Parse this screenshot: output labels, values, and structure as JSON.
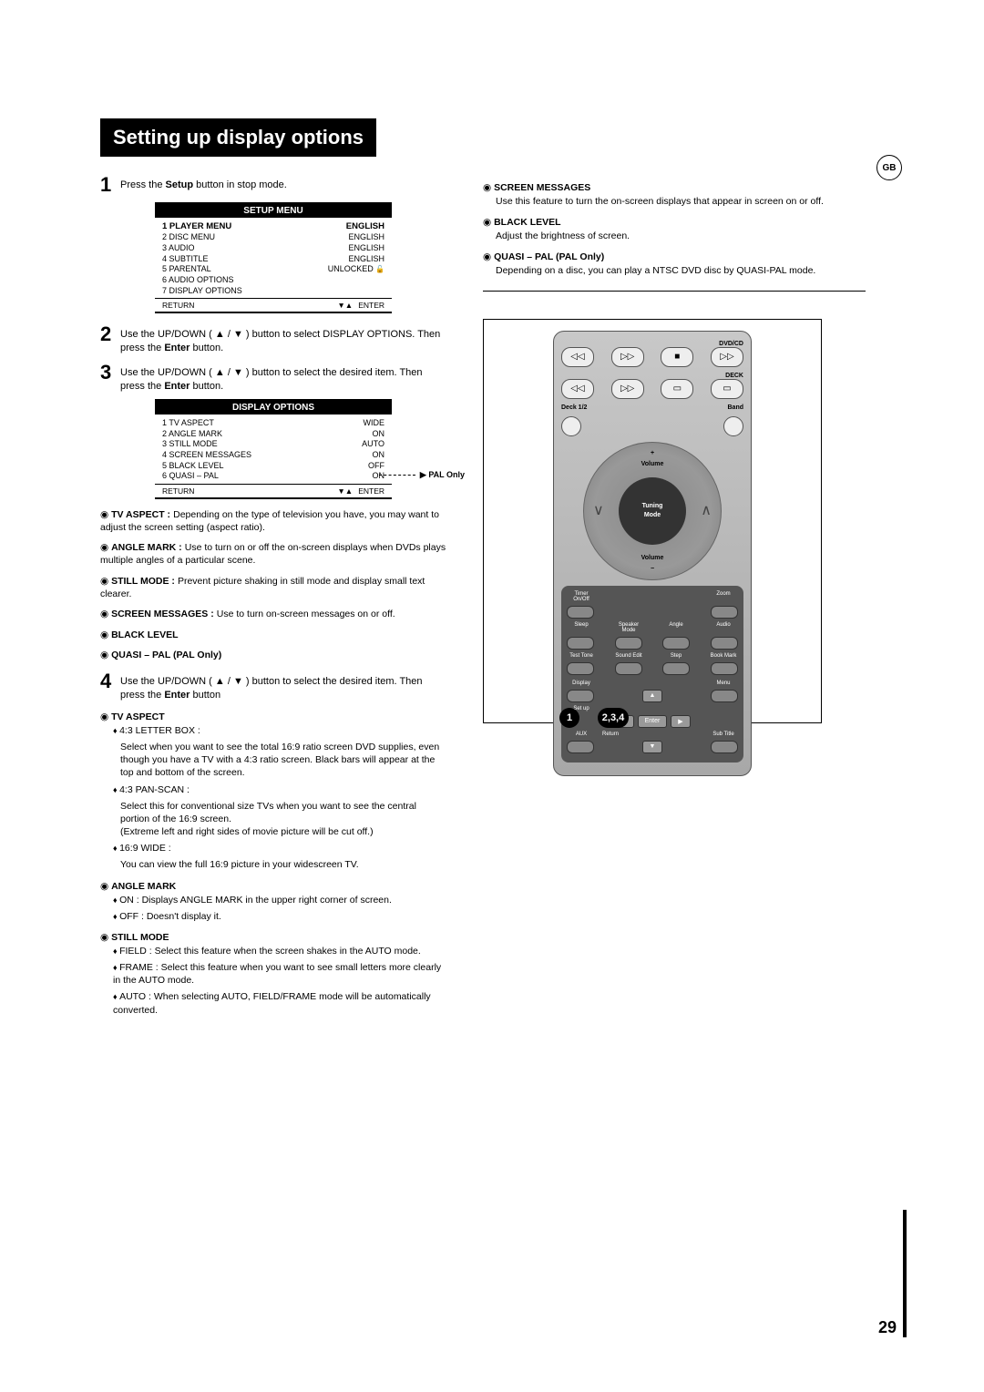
{
  "badge": "GB",
  "title": "Setting up display options",
  "page_num": "29",
  "steps": {
    "s1": {
      "num": "1",
      "text_a": "Press the ",
      "bold": "Setup",
      "text_b": " button in stop mode."
    },
    "s2": {
      "num": "2",
      "text_a": "Use the UP/DOWN ( ▲ / ▼ ) button to select DISPLAY OPTIONS. Then press the ",
      "bold": "Enter",
      "text_b": " button."
    },
    "s3": {
      "num": "3",
      "text_a": "Use the UP/DOWN ( ▲ / ▼ ) button to select the desired item. Then press the ",
      "bold": "Enter",
      "text_b": " button."
    },
    "s4": {
      "num": "4",
      "text_a": "Use the UP/DOWN ( ▲ / ▼ ) button to select the desired item. Then press the ",
      "bold": "Enter",
      "text_b": " button"
    }
  },
  "menu1": {
    "header": "SETUP MENU",
    "rows": [
      {
        "l": "1 PLAYER MENU",
        "r": "ENGLISH",
        "bold": true
      },
      {
        "l": "2 DISC MENU",
        "r": "ENGLISH"
      },
      {
        "l": "3 AUDIO",
        "r": "ENGLISH"
      },
      {
        "l": "4 SUBTITLE",
        "r": "ENGLISH"
      },
      {
        "l": "5 PARENTAL",
        "r": "UNLOCKED",
        "lock": true
      },
      {
        "l": "6 AUDIO OPTIONS",
        "r": ""
      },
      {
        "l": "7 DISPLAY OPTIONS",
        "r": ""
      }
    ],
    "return": "RETURN",
    "enter": "ENTER"
  },
  "menu2": {
    "header": "DISPLAY OPTIONS",
    "rows": [
      {
        "l": "1 TV ASPECT",
        "r": "WIDE"
      },
      {
        "l": "2 ANGLE MARK",
        "r": "ON"
      },
      {
        "l": "3 STILL MODE",
        "r": "AUTO"
      },
      {
        "l": "4 SCREEN MESSAGES",
        "r": "ON"
      },
      {
        "l": "5 BLACK LEVEL",
        "r": "OFF"
      },
      {
        "l": "6 QUASI – PAL",
        "r": "ON"
      }
    ],
    "return": "RETURN",
    "enter": "ENTER",
    "pal_note": "PAL Only"
  },
  "defs_left": {
    "tv_aspect": {
      "h": "TV ASPECT :",
      "d": "Depending on the type of television you have, you may want to adjust the screen setting (aspect ratio)."
    },
    "angle_mark": {
      "h": "ANGLE MARK :",
      "d": "Use to turn on or off the on-screen displays when DVDs plays multiple angles of a particular scene."
    },
    "still_mode": {
      "h": "STILL MODE :",
      "d": "Prevent picture shaking in still mode and display small text clearer."
    },
    "screen_msg": {
      "h": "SCREEN MESSAGES :",
      "d": "Use to turn on-screen messages on or off."
    },
    "black_level": {
      "h": "BLACK LEVEL"
    },
    "quasi_pal": {
      "h": "QUASI – PAL (PAL Only)"
    }
  },
  "tv_aspect_section": {
    "head": "TV ASPECT",
    "items": [
      {
        "t": "4:3 LETTER BOX :",
        "d": "Select when you want to see the total 16:9 ratio screen DVD supplies, even though you have a TV with a 4:3 ratio screen. Black bars will appear at the top and bottom of the screen."
      },
      {
        "t": "4:3 PAN-SCAN :",
        "d": "Select this for conventional size TVs when you want to see the central portion of the 16:9 screen.\n(Extreme left and right sides of movie picture will be cut off.)"
      },
      {
        "t": "16:9 WIDE :",
        "d": "You can view the full 16:9 picture in your widescreen TV."
      }
    ]
  },
  "angle_mark_section": {
    "head": "ANGLE MARK",
    "items": [
      {
        "t": "ON : Displays ANGLE MARK in the upper right corner of screen."
      },
      {
        "t": "OFF : Doesn't display it."
      }
    ]
  },
  "still_mode_section": {
    "head": "STILL MODE",
    "items": [
      {
        "t": "FIELD : Select this feature when the screen shakes in the AUTO mode."
      },
      {
        "t": "FRAME : Select this feature when you want to see small letters more clearly in the AUTO mode."
      },
      {
        "t": "AUTO : When selecting AUTO, FIELD/FRAME mode will be automatically converted."
      }
    ]
  },
  "right_defs": {
    "screen_msg": {
      "h": "SCREEN MESSAGES",
      "d": "Use this feature to turn the on-screen displays that appear in screen on or off."
    },
    "black_level": {
      "h": "BLACK LEVEL",
      "d": "Adjust the brightness of screen."
    },
    "quasi_pal": {
      "h": "QUASI – PAL (PAL Only)",
      "d": "Depending on a disc, you can play a NTSC DVD disc by QUASI-PAL mode."
    }
  },
  "remote": {
    "dvdcd": "DVD/CD",
    "deck": "DECK",
    "deck12": "Deck 1/2",
    "band": "Band",
    "plus": "+",
    "minus": "−",
    "volume": "Volume",
    "tuning": "Tuning",
    "mode": "Mode",
    "timer": "Timer On/Off",
    "zoom": "Zoom",
    "sleep": "Sleep",
    "speaker": "Speaker Mode",
    "angle": "Angle",
    "audio": "Audio",
    "test": "Test Tone",
    "sound": "Sound Edit",
    "step": "Step",
    "book": "Book Mark",
    "display": "Display",
    "menu": "Menu",
    "setup": "Set up",
    "aux": "AUX",
    "return": "Return",
    "enter": "Enter",
    "sub": "Sub Title",
    "badge1": "1",
    "badge234": "2,3,4"
  }
}
